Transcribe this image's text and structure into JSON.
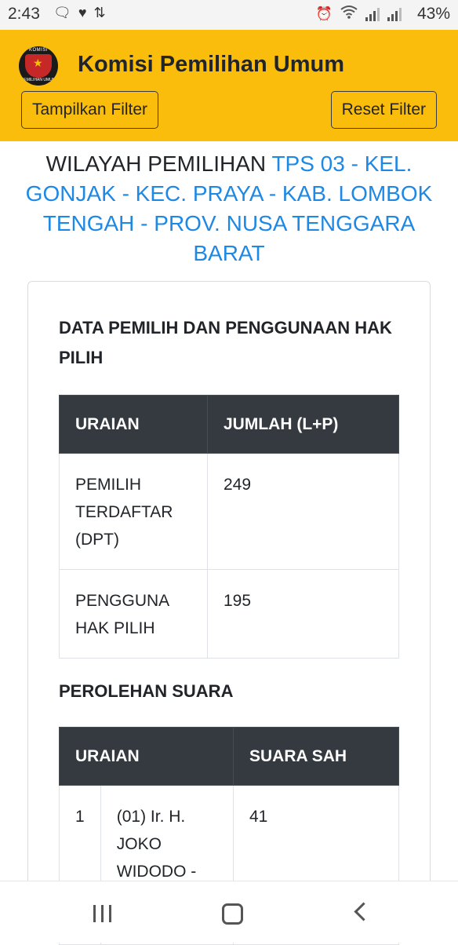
{
  "status_bar": {
    "time": "2:43",
    "battery": "43%",
    "left_icons": [
      "message-icon",
      "heart-icon",
      "retweet-icon"
    ],
    "right_icons": [
      "alarm-icon",
      "wifi-icon",
      "signal-icon",
      "signal-icon"
    ]
  },
  "header": {
    "logo": {
      "top_text": "KOMISI",
      "bottom_text": "PEMILIHAN UMUM"
    },
    "title": "Komisi Pemilihan Umum",
    "filter_button": "Tampilkan Filter",
    "reset_button": "Reset Filter",
    "background_color": "#fbbd0b"
  },
  "region": {
    "label": "WILAYAH PEMILIHAN",
    "value": "TPS 03 - KEL. GONJAK - KEC. PRAYA - KAB. LOMBOK TENGAH - PROV. NUSA TENGGARA BARAT",
    "value_color": "#1e88e5"
  },
  "voter_section": {
    "title": "DATA PEMILIH DAN PENGGUNAAN HAK PILIH",
    "headers": [
      "URAIAN",
      "JUMLAH (L+P)"
    ],
    "rows": [
      {
        "label": "PEMILIH TERDAFTAR (DPT)",
        "value": "249"
      },
      {
        "label": "PENGGUNA HAK PILIH",
        "value": "195"
      }
    ]
  },
  "votes_section": {
    "title": "PEROLEHAN SUARA",
    "headers": [
      "URAIAN",
      "SUARA SAH"
    ],
    "rows": [
      {
        "no": "1",
        "name": "(01) Ir. H. JOKO WIDODO -",
        "votes": "41"
      }
    ]
  },
  "nav_bar": {
    "icons": [
      "recents-icon",
      "home-icon",
      "back-icon"
    ]
  }
}
